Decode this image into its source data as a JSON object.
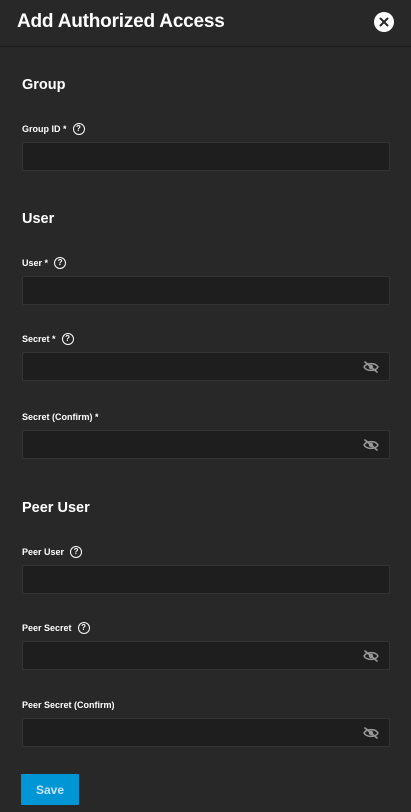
{
  "dialog": {
    "title": "Add Authorized Access",
    "close_icon": "close-icon"
  },
  "sections": {
    "group": {
      "title": "Group",
      "group_id": {
        "label": "Group ID *",
        "value": "",
        "help_icon": "help-icon"
      }
    },
    "user": {
      "title": "User",
      "user": {
        "label": "User *",
        "value": "",
        "help_icon": "help-icon"
      },
      "secret": {
        "label": "Secret *",
        "value": "",
        "help_icon": "help-icon",
        "visibility_icon": "eye-off-icon"
      },
      "secret_confirm": {
        "label": "Secret (Confirm) *",
        "value": "",
        "visibility_icon": "eye-off-icon"
      }
    },
    "peer_user": {
      "title": "Peer User",
      "peer_user": {
        "label": "Peer User",
        "value": "",
        "help_icon": "help-icon"
      },
      "peer_secret": {
        "label": "Peer Secret",
        "value": "",
        "help_icon": "help-icon",
        "visibility_icon": "eye-off-icon"
      },
      "peer_secret_confirm": {
        "label": "Peer Secret (Confirm)",
        "value": "",
        "visibility_icon": "eye-off-icon"
      }
    }
  },
  "actions": {
    "save_label": "Save",
    "save_disabled": true
  },
  "colors": {
    "background": "#282828",
    "input_background": "#1e1e1e",
    "primary": "#0095d5"
  }
}
